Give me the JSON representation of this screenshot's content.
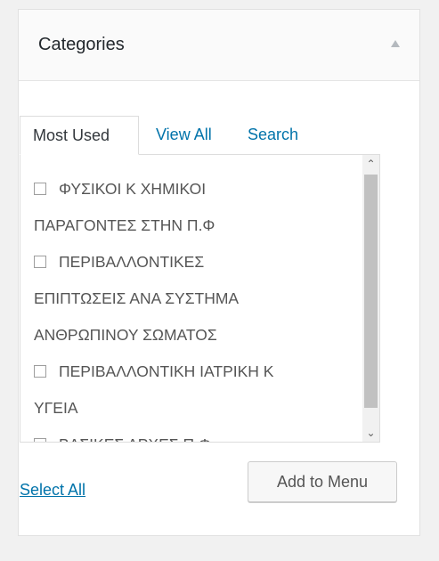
{
  "panel": {
    "title": "Categories",
    "collapse_icon": "triangle-up-icon"
  },
  "tabs": [
    {
      "label": "Most Used",
      "active": true
    },
    {
      "label": "View All",
      "active": false
    },
    {
      "label": "Search",
      "active": false
    }
  ],
  "items": [
    {
      "line1": "ΦΥΣΙΚΟΙ Κ ΧΗΜΙΚΟΙ",
      "line2": "ΠΑΡΑΓΟΝΤΕΣ ΣΤΗΝ Π.Φ",
      "line3": "",
      "checked": false
    },
    {
      "line1": "ΠΕΡΙΒΑΛΛΟΝΤΙΚΕΣ",
      "line2": "ΕΠΙΠΤΩΣΕΙΣ ΑΝΑ ΣΥΣΤΗΜΑ",
      "line3": "ΑΝΘΡΩΠΙΝΟΥ ΣΩΜΑΤΟΣ",
      "checked": false
    },
    {
      "line1": "ΠΕΡΙΒΑΛΛΟΝΤΙΚΗ ΙΑΤΡΙΚΗ Κ",
      "line2": "ΥΓΕΙΑ",
      "line3": "",
      "checked": false
    },
    {
      "line1": "ΒΑΣΙΚΕΣ ΑΡΧΕΣ Π.Φ",
      "line2": "",
      "line3": "",
      "checked": false
    }
  ],
  "footer": {
    "select_all_label": "Select All",
    "add_button_label": "Add to Menu"
  },
  "colors": {
    "link": "#0073aa",
    "panel_bg": "#ffffff",
    "page_bg": "#f1f1f1"
  }
}
